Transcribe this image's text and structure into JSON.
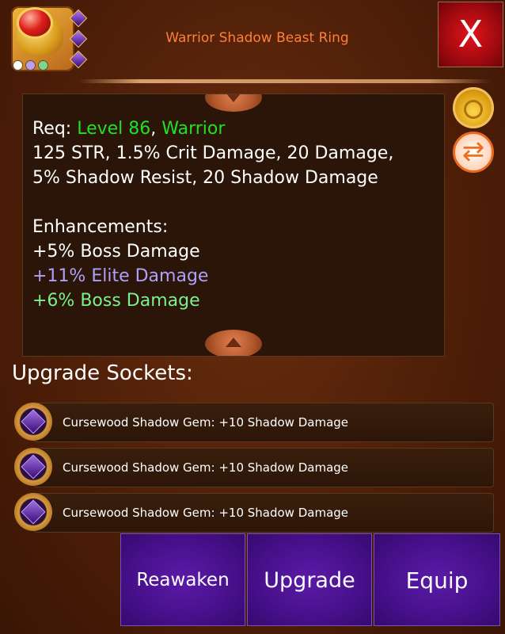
{
  "item": {
    "title": "Warrior Shadow Beast Ring",
    "icon": "gold-ruby-ring-icon",
    "rarity_dots": [
      "#ffffff",
      "#b8a0f0",
      "#7ad890"
    ]
  },
  "close_label": "X",
  "description": {
    "req_prefix": "Req: ",
    "req_level": "Level 86",
    "req_sep": ", ",
    "req_class": "Warrior",
    "stats_line1": "125 STR, 1.5% Crit Damage, 20 Damage,",
    "stats_line2": "5% Shadow Resist, 20 Shadow Damage",
    "enhancements_heading": "Enhancements:",
    "enhancements": [
      {
        "text": "+5% Boss Damage",
        "color": "#ffffff"
      },
      {
        "text": "+11% Elite Damage",
        "color": "#b0a0f8"
      },
      {
        "text": "+6% Boss Damage",
        "color": "#7cf08a"
      }
    ]
  },
  "side_icons": [
    "coin-bag-icon",
    "swap-icon"
  ],
  "sockets": {
    "heading": "Upgrade Sockets:",
    "items": [
      {
        "label": "Cursewood Shadow Gem: +10 Shadow Damage"
      },
      {
        "label": "Cursewood Shadow Gem: +10 Shadow Damage"
      },
      {
        "label": "Cursewood Shadow Gem: +10 Shadow Damage"
      }
    ]
  },
  "buttons": {
    "reawaken": "Reawaken",
    "upgrade": "Upgrade",
    "equip": "Equip"
  },
  "colors": {
    "title": "#ff7f3a",
    "req_green": "#22e022",
    "button_purple": "#46108a",
    "close_red": "#c80e14"
  }
}
